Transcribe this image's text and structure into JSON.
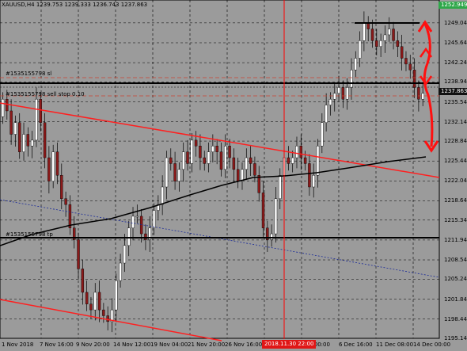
{
  "window": {
    "title": "XAUUSD,H4  1239.753 1239.333 1236.743 1237.863"
  },
  "order_labels": {
    "sl": "#1535155798 sl",
    "sell_stop": "#1535155798 sell stop 0.10",
    "tp": "#1535155798 tp"
  },
  "price_axis": {
    "ticks": [
      "1249.040",
      "1245.640",
      "1242.240",
      "1238.940",
      "1235.540",
      "1232.140",
      "1228.840",
      "1225.440",
      "1222.040",
      "1218.640",
      "1215.340",
      "1211.940",
      "1208.540",
      "1205.240",
      "1201.840",
      "1198.440",
      "1195.140"
    ],
    "current_price": "1237.863",
    "top_price": "1252.949"
  },
  "time_axis": {
    "ticks": [
      "1 Nov 2018",
      "7 Nov 16:00",
      "9 Nov 20:00",
      "14 Nov 12:00",
      "19 Nov 04:00",
      "21 Nov 20:00",
      "26 Nov 16:00",
      "Dec 00:00",
      "6 Dec 16:00",
      "11 Dec 08:00",
      "14 Dec 00:00"
    ],
    "highlighted": "2018.11.30 22:00"
  },
  "colors": {
    "background": "#9b9b9b",
    "trendline": "#ff2020",
    "marker": "#ff0000",
    "moving_average": "#000000",
    "grid": "#000000"
  },
  "chart_data": {
    "type": "candlestick",
    "symbol": "XAUUSD",
    "timeframe": "H4",
    "ohlc": {
      "open": 1239.753,
      "high": 1239.333,
      "low": 1236.743,
      "close": 1237.863
    },
    "ylim": [
      1195.14,
      1252.949
    ],
    "x_ticks": [
      "1 Nov 2018",
      "7 Nov 16:00",
      "9 Nov 20:00",
      "14 Nov 12:00",
      "19 Nov 04:00",
      "21 Nov 20:00",
      "26 Nov 16:00",
      "Dec 00:00",
      "6 Dec 16:00",
      "11 Dec 08:00",
      "14 Dec 00:00"
    ],
    "y_ticks": [
      1249.04,
      1245.64,
      1242.24,
      1238.94,
      1235.54,
      1232.14,
      1228.84,
      1225.44,
      1222.04,
      1218.64,
      1215.34,
      1211.94,
      1208.54,
      1205.24,
      1201.84,
      1198.44,
      1195.14
    ],
    "levels": {
      "sl": 1240.9,
      "sell_stop": 1236.9,
      "tp": 1211.9,
      "high_line": 1249.7
    },
    "closes": [
      1236,
      1234,
      1230,
      1232,
      1227,
      1230,
      1228,
      1229,
      1236,
      1232,
      1226,
      1222,
      1227,
      1223,
      1219,
      1218,
      1214,
      1212,
      1207,
      1203,
      1201,
      1200,
      1203,
      1200,
      1199,
      1198,
      1200,
      1205,
      1208,
      1211,
      1214,
      1216,
      1216,
      1213,
      1212,
      1214,
      1217,
      1218,
      1221,
      1226,
      1225,
      1222,
      1224,
      1227,
      1225,
      1229,
      1228,
      1226,
      1225,
      1227,
      1228,
      1227,
      1224,
      1228,
      1226,
      1224,
      1222,
      1224,
      1226,
      1225,
      1223,
      1220,
      1214,
      1212,
      1213,
      1219,
      1223,
      1226,
      1225,
      1226,
      1228,
      1226,
      1225,
      1221,
      1223,
      1228,
      1232,
      1235,
      1236,
      1237,
      1238,
      1236,
      1238,
      1241,
      1243,
      1246,
      1249,
      1248,
      1246,
      1245,
      1246,
      1247,
      1248,
      1246,
      1245,
      1243,
      1242,
      1241,
      1238,
      1236,
      1237
    ]
  }
}
